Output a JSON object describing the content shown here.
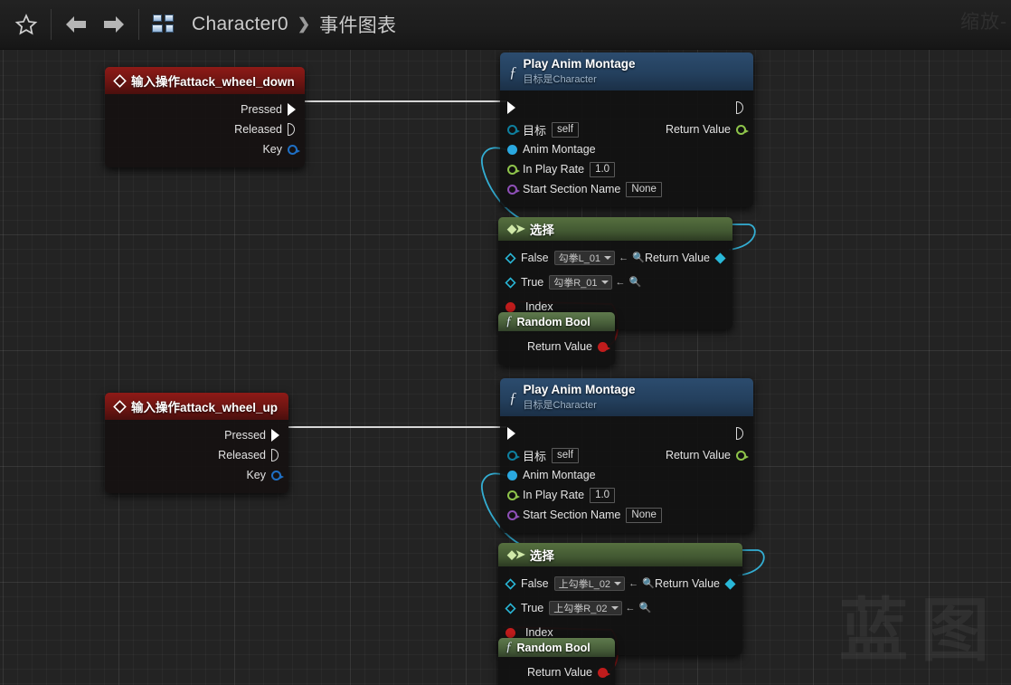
{
  "toolbar": {
    "favorite_icon": "star-icon",
    "back_icon": "arrow-left-icon",
    "forward_icon": "arrow-right-icon",
    "blueprint_icon": "blueprint-grid-icon",
    "breadcrumb": {
      "root": "Character0",
      "separator": "❯",
      "current": "事件图表"
    },
    "zoom_label": "缩放-"
  },
  "watermark": "蓝图",
  "colors": {
    "exec_white": "#ffffff",
    "object_blue": "#0e7f9e",
    "montage_blue": "#2aa8e0",
    "float_green": "#8ec44a",
    "name_purple": "#8e4fb8",
    "bool_red": "#c01c1c",
    "wildcard_cyan": "#29b8d8",
    "event_header": "#7a1714",
    "function_header": "#274564",
    "pure_header": "#4d6440"
  },
  "nodes": [
    {
      "id": "event-attack-wheel-down",
      "kind": "event",
      "title": "输入操作attack_wheel_down",
      "subtitle": "",
      "outputs": [
        {
          "label": "Pressed",
          "pin": "exec-solid"
        },
        {
          "label": "Released",
          "pin": "exec-hollow"
        },
        {
          "label": "Key",
          "pin": "key-struct"
        }
      ]
    },
    {
      "id": "play-anim-montage-1",
      "kind": "function",
      "title": "Play Anim Montage",
      "subtitle": "目标是Character",
      "exec_in": "",
      "exec_out": "",
      "inputs": [
        {
          "label": "目标",
          "value": "self",
          "pin": "object"
        },
        {
          "label": "Anim Montage",
          "value": "",
          "pin": "montage"
        },
        {
          "label": "In Play Rate",
          "value": "1.0",
          "pin": "float"
        },
        {
          "label": "Start Section Name",
          "value": "None",
          "pin": "name"
        }
      ],
      "outputs": [
        {
          "label": "Return Value",
          "pin": "float"
        }
      ]
    },
    {
      "id": "select-1",
      "kind": "select",
      "title": "选择",
      "inputs": [
        {
          "label": "False",
          "value": "勾拳L_01",
          "pin": "wildcard"
        },
        {
          "label": "True",
          "value": "勾拳R_01",
          "pin": "wildcard"
        },
        {
          "label": "Index",
          "value": "",
          "pin": "bool"
        }
      ],
      "outputs": [
        {
          "label": "Return Value",
          "pin": "wildcard"
        }
      ]
    },
    {
      "id": "random-bool-1",
      "kind": "pure",
      "title": "Random Bool",
      "outputs": [
        {
          "label": "Return Value",
          "pin": "bool"
        }
      ]
    },
    {
      "id": "event-attack-wheel-up",
      "kind": "event",
      "title": "输入操作attack_wheel_up",
      "subtitle": "",
      "outputs": [
        {
          "label": "Pressed",
          "pin": "exec-solid"
        },
        {
          "label": "Released",
          "pin": "exec-hollow"
        },
        {
          "label": "Key",
          "pin": "key-struct"
        }
      ]
    },
    {
      "id": "play-anim-montage-2",
      "kind": "function",
      "title": "Play Anim Montage",
      "subtitle": "目标是Character",
      "inputs": [
        {
          "label": "目标",
          "value": "self",
          "pin": "object"
        },
        {
          "label": "Anim Montage",
          "value": "",
          "pin": "montage"
        },
        {
          "label": "In Play Rate",
          "value": "1.0",
          "pin": "float"
        },
        {
          "label": "Start Section Name",
          "value": "None",
          "pin": "name"
        }
      ],
      "outputs": [
        {
          "label": "Return Value",
          "pin": "float"
        }
      ]
    },
    {
      "id": "select-2",
      "kind": "select",
      "title": "选择",
      "inputs": [
        {
          "label": "False",
          "value": "上勾拳L_02",
          "pin": "wildcard"
        },
        {
          "label": "True",
          "value": "上勾拳R_02",
          "pin": "wildcard"
        },
        {
          "label": "Index",
          "value": "",
          "pin": "bool"
        }
      ],
      "outputs": [
        {
          "label": "Return Value",
          "pin": "wildcard"
        }
      ]
    },
    {
      "id": "random-bool-2",
      "kind": "pure",
      "title": "Random Bool",
      "outputs": [
        {
          "label": "Return Value",
          "pin": "bool"
        }
      ]
    }
  ]
}
